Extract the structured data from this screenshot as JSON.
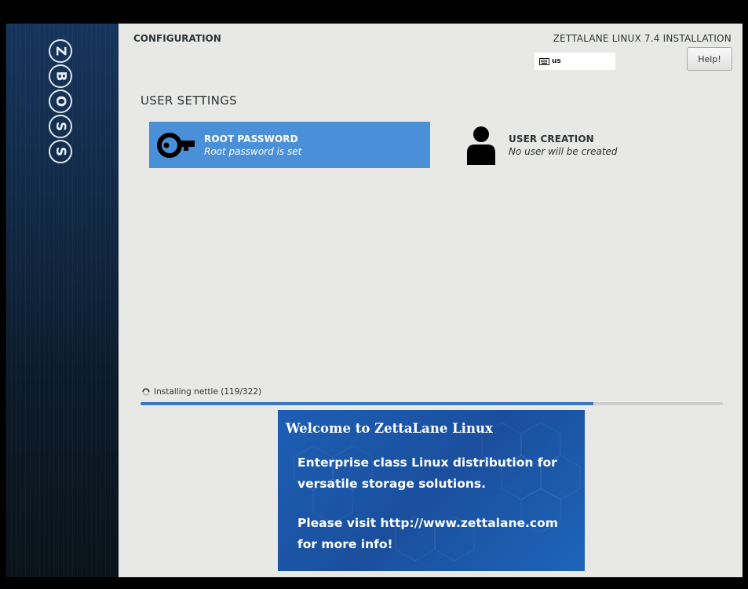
{
  "sidebar": {
    "logo_text": "ZBOSS",
    "logo_letters": [
      "Z",
      "B",
      "O",
      "S",
      "S"
    ]
  },
  "header": {
    "config_title": "CONFIGURATION",
    "install_title": "ZETTALANE LINUX 7.4 INSTALLATION",
    "keyboard_layout": "us",
    "keyboard_icon": "keyboard-icon",
    "help_label": "Help!"
  },
  "section": {
    "title": "USER SETTINGS"
  },
  "spokes": {
    "root": {
      "name": "ROOT PASSWORD",
      "status": "Root password is set",
      "icon": "key-icon",
      "selected": true
    },
    "user": {
      "name": "USER CREATION",
      "status": "No user will be created",
      "icon": "user-icon",
      "selected": false
    }
  },
  "progress": {
    "text": "Installing nettle (119/322)",
    "fraction": 0.777
  },
  "banner": {
    "title": "Welcome to ZettaLane Linux",
    "line1": "Enterprise class Linux distribution for",
    "line2": "versatile storage solutions.",
    "line3": "Please visit http://www.zettalane.com",
    "line4": "for more info!"
  },
  "colors": {
    "accent": "#4a90d9",
    "progress": "#3a78c3",
    "banner": "#1c5fb4",
    "background": "#e8e8e7"
  }
}
